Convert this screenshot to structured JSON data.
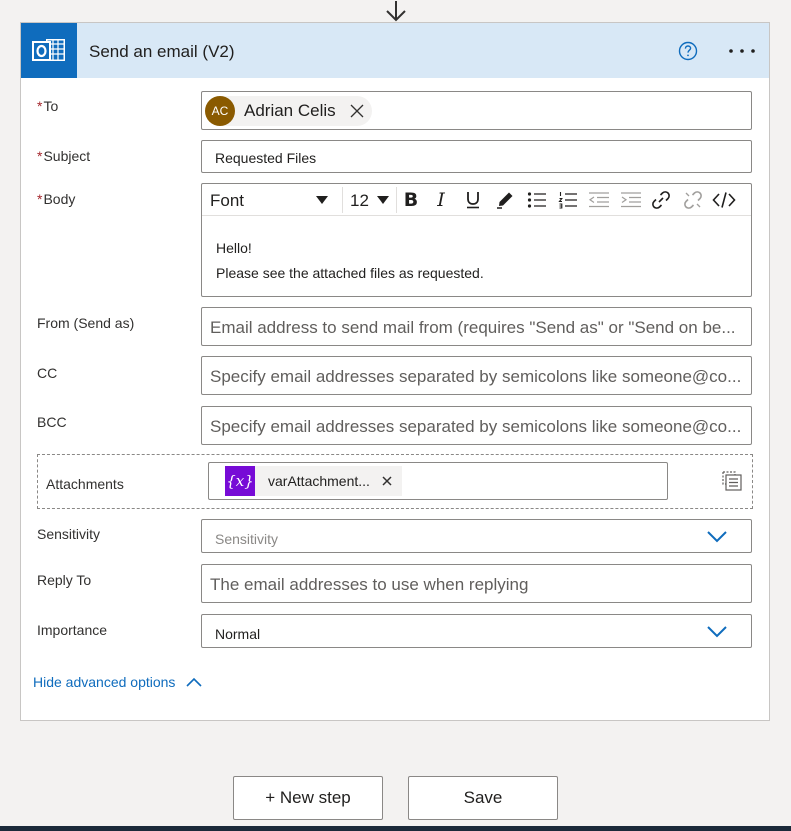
{
  "card": {
    "title": "Send an email (V2)",
    "header_color": "#d8e8f6",
    "accent": "#0f6cbd"
  },
  "fields": {
    "to": {
      "label": "To",
      "required": "*",
      "token_initials": "AC",
      "token_name": "Adrian Celis"
    },
    "subject": {
      "label": "Subject",
      "required": "*",
      "value": "Requested Files"
    },
    "body": {
      "label": "Body",
      "required": "*",
      "font": "Font",
      "font_size": "12",
      "line1": "Hello!",
      "line2": "Please see the attached files as requested.",
      "toolbar_icons": [
        "bold-icon",
        "italic-icon",
        "underline-icon",
        "highlight-pen-icon",
        "bullet-list-icon",
        "numbered-list-icon",
        "decrease-indent-icon",
        "increase-indent-icon",
        "link-icon",
        "unlink-icon",
        "code-view-icon"
      ]
    },
    "from": {
      "label": "From (Send as)",
      "placeholder": "Email address to send mail from (requires \"Send as\" or \"Send on be..."
    },
    "cc": {
      "label": "CC",
      "placeholder": "Specify email addresses separated by semicolons like someone@co..."
    },
    "bcc": {
      "label": "BCC",
      "placeholder": "Specify email addresses separated by semicolons like someone@co..."
    },
    "attachments": {
      "label": "Attachments",
      "var_glyph": "{x}",
      "var_name": "varAttachment...",
      "close_glyph": "×"
    },
    "sensitivity": {
      "label": "Sensitivity",
      "placeholder": "Sensitivity"
    },
    "reply_to": {
      "label": "Reply To",
      "placeholder": "The email addresses to use when replying"
    },
    "importance": {
      "label": "Importance",
      "value": "Normal"
    }
  },
  "links": {
    "hide_advanced": "Hide advanced options"
  },
  "footer": {
    "new_step": "+ New step",
    "save": "Save"
  }
}
